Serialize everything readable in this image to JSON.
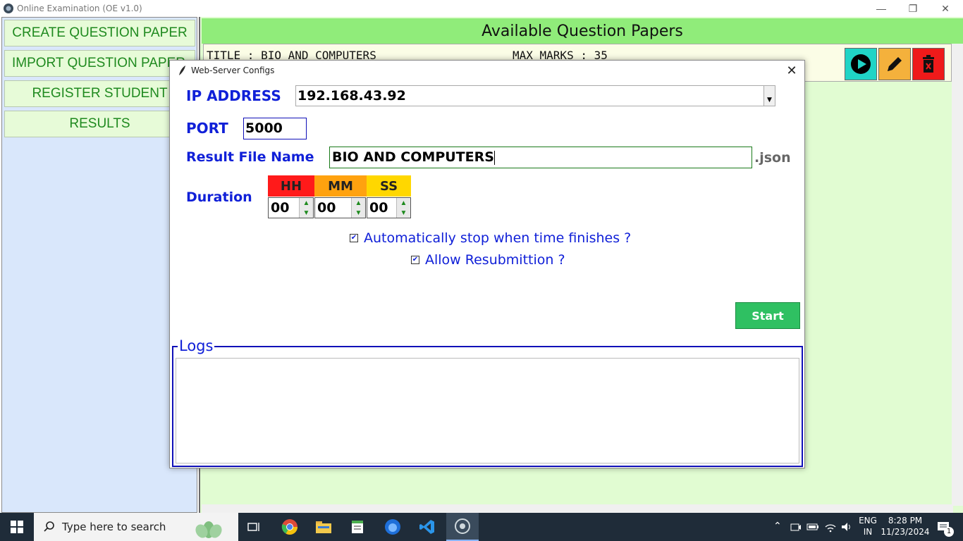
{
  "window": {
    "title": "Online Examination (OE v1.0)"
  },
  "sidebar": {
    "items": [
      {
        "label": "CREATE QUESTION PAPER"
      },
      {
        "label": "IMPORT QUESTION PAPER"
      },
      {
        "label": "REGISTER STUDENT"
      },
      {
        "label": "RESULTS"
      }
    ]
  },
  "main": {
    "header": "Available Question Papers",
    "papers": [
      {
        "title": "TITLE : BIO AND COMPUTERS",
        "max_marks": "MAX MARKS : 35"
      }
    ],
    "actions": {
      "start_icon": "play-circle-icon",
      "edit_icon": "pencil-icon",
      "delete_icon": "trash-icon"
    },
    "colors": {
      "start": "#20d4c6",
      "edit": "#f4b13c",
      "delete": "#ef1a1a"
    }
  },
  "dialog": {
    "title": "Web-Server Configs",
    "ip_label": "IP ADDRESS",
    "ip_value": "192.168.43.92",
    "port_label": "PORT",
    "port_value": "5000",
    "result_label": "Result File Name",
    "result_value": "BIO AND COMPUTERS",
    "result_ext": ".json",
    "duration_label": "Duration",
    "duration": {
      "hh_label": "HH",
      "mm_label": "MM",
      "ss_label": "SS",
      "hh": "00",
      "mm": "00",
      "ss": "00",
      "colors": {
        "hh": "#ff1a1a",
        "mm": "#ffa20f",
        "ss": "#ffd700"
      }
    },
    "auto_stop_label": "Automatically stop when time finishes ?",
    "auto_stop_checked": true,
    "resubmit_label": "Allow Resubmittion ?",
    "resubmit_checked": true,
    "start_label": "Start",
    "logs_label": "Logs"
  },
  "taskbar": {
    "search_placeholder": "Type here to search",
    "lang": "ENG",
    "region": "IN",
    "time": "8:28 PM",
    "date": "11/23/2024",
    "notification_count": "1"
  }
}
